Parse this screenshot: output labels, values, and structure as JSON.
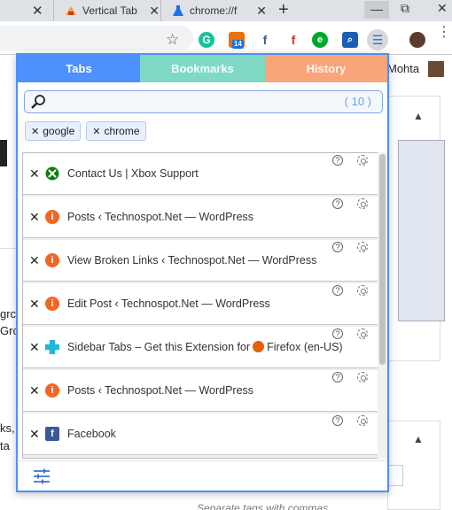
{
  "browser": {
    "tabs": [
      {
        "title": "Vertical Tab"
      },
      {
        "title": "chrome://f"
      }
    ],
    "new_tab_label": "+",
    "window": {
      "minimize": "—",
      "maximize": "⧉",
      "close": "✕"
    },
    "extension_badge": "14",
    "accent": "#1a73e8"
  },
  "background_page": {
    "profile_name": "Mohta",
    "text_fragments": [
      "grc",
      "Grc",
      "ks,",
      "ta"
    ],
    "hint_text": "Separate tags with commas"
  },
  "popup": {
    "tabs": [
      {
        "label": "Tabs",
        "color": "#4d90fe",
        "active": true
      },
      {
        "label": "Bookmarks",
        "color": "#7fd9c5",
        "active": false
      },
      {
        "label": "History",
        "color": "#f9a57a",
        "active": false
      }
    ],
    "search": {
      "value": "",
      "placeholder": "",
      "count": "( 10 )"
    },
    "filters": [
      {
        "label": "google"
      },
      {
        "label": "chrome"
      }
    ],
    "tab_list": [
      {
        "title": "Contact Us | Xbox Support",
        "icon": "xbox-icon"
      },
      {
        "title": "Posts ‹ Technospot.Net — WordPress",
        "icon": "wordpress-icon"
      },
      {
        "title": "View Broken Links ‹ Technospot.Net — WordPress",
        "icon": "wordpress-icon"
      },
      {
        "title": "Edit Post ‹ Technospot.Net — WordPress",
        "icon": "wordpress-icon"
      },
      {
        "title_before": "Sidebar Tabs – Get this Extension for",
        "title_after": "Firefox (en-US)",
        "icon": "puzzle-icon"
      },
      {
        "title": "Posts ‹ Technospot.Net — WordPress",
        "icon": "wordpress-icon"
      },
      {
        "title": "Facebook",
        "icon": "facebook-icon"
      }
    ],
    "close_glyph": "✕",
    "help_glyph": "?",
    "scroll_position": 0
  }
}
